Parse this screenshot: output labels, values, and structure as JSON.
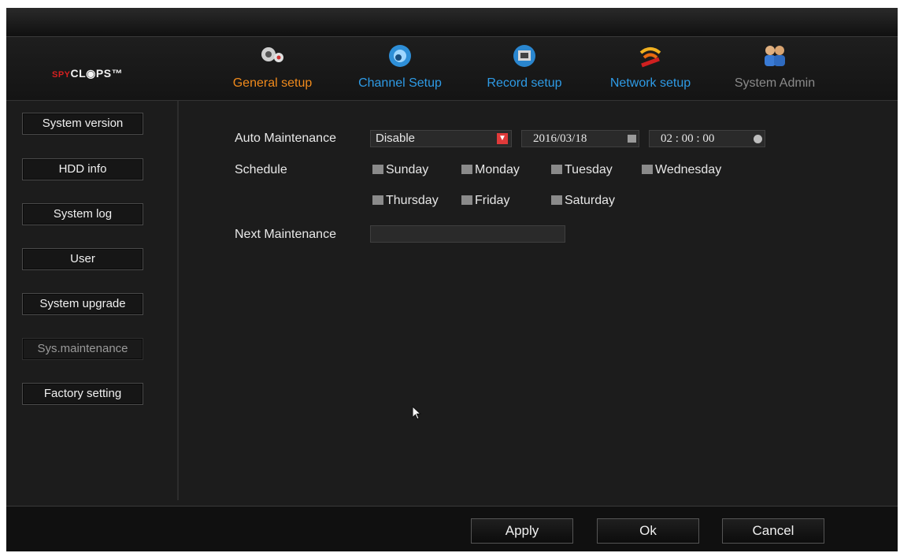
{
  "logo": {
    "prefix": "SPY",
    "main": "CL◉PS™"
  },
  "tabs": [
    {
      "label": "General setup",
      "icon": "gears-icon",
      "color": "#f08a1c"
    },
    {
      "label": "Channel Setup",
      "icon": "camera-icon",
      "color": "#2e9be6"
    },
    {
      "label": "Record setup",
      "icon": "recorder-icon",
      "color": "#2e9be6"
    },
    {
      "label": "Network setup",
      "icon": "wifi-icon",
      "color": "#2e9be6"
    },
    {
      "label": "System Admin",
      "icon": "users-icon",
      "color": "#8a8a8a"
    }
  ],
  "sidebar": {
    "items": [
      {
        "label": "System version"
      },
      {
        "label": "HDD info"
      },
      {
        "label": "System log"
      },
      {
        "label": "User"
      },
      {
        "label": "System upgrade"
      },
      {
        "label": "Sys.maintenance",
        "active": true
      },
      {
        "label": "Factory setting"
      }
    ]
  },
  "form": {
    "auto_maintenance_label": "Auto Maintenance",
    "auto_maintenance_value": "Disable",
    "date_value": "2016/03/18",
    "time_value": "02 : 00 : 00",
    "schedule_label": "Schedule",
    "days": [
      "Sunday",
      "Monday",
      "Tuesday",
      "Wednesday",
      "Thursday",
      "Friday",
      "Saturday"
    ],
    "next_maintenance_label": "Next Maintenance",
    "next_maintenance_value": ""
  },
  "footer": {
    "apply": "Apply",
    "ok": "Ok",
    "cancel": "Cancel"
  }
}
